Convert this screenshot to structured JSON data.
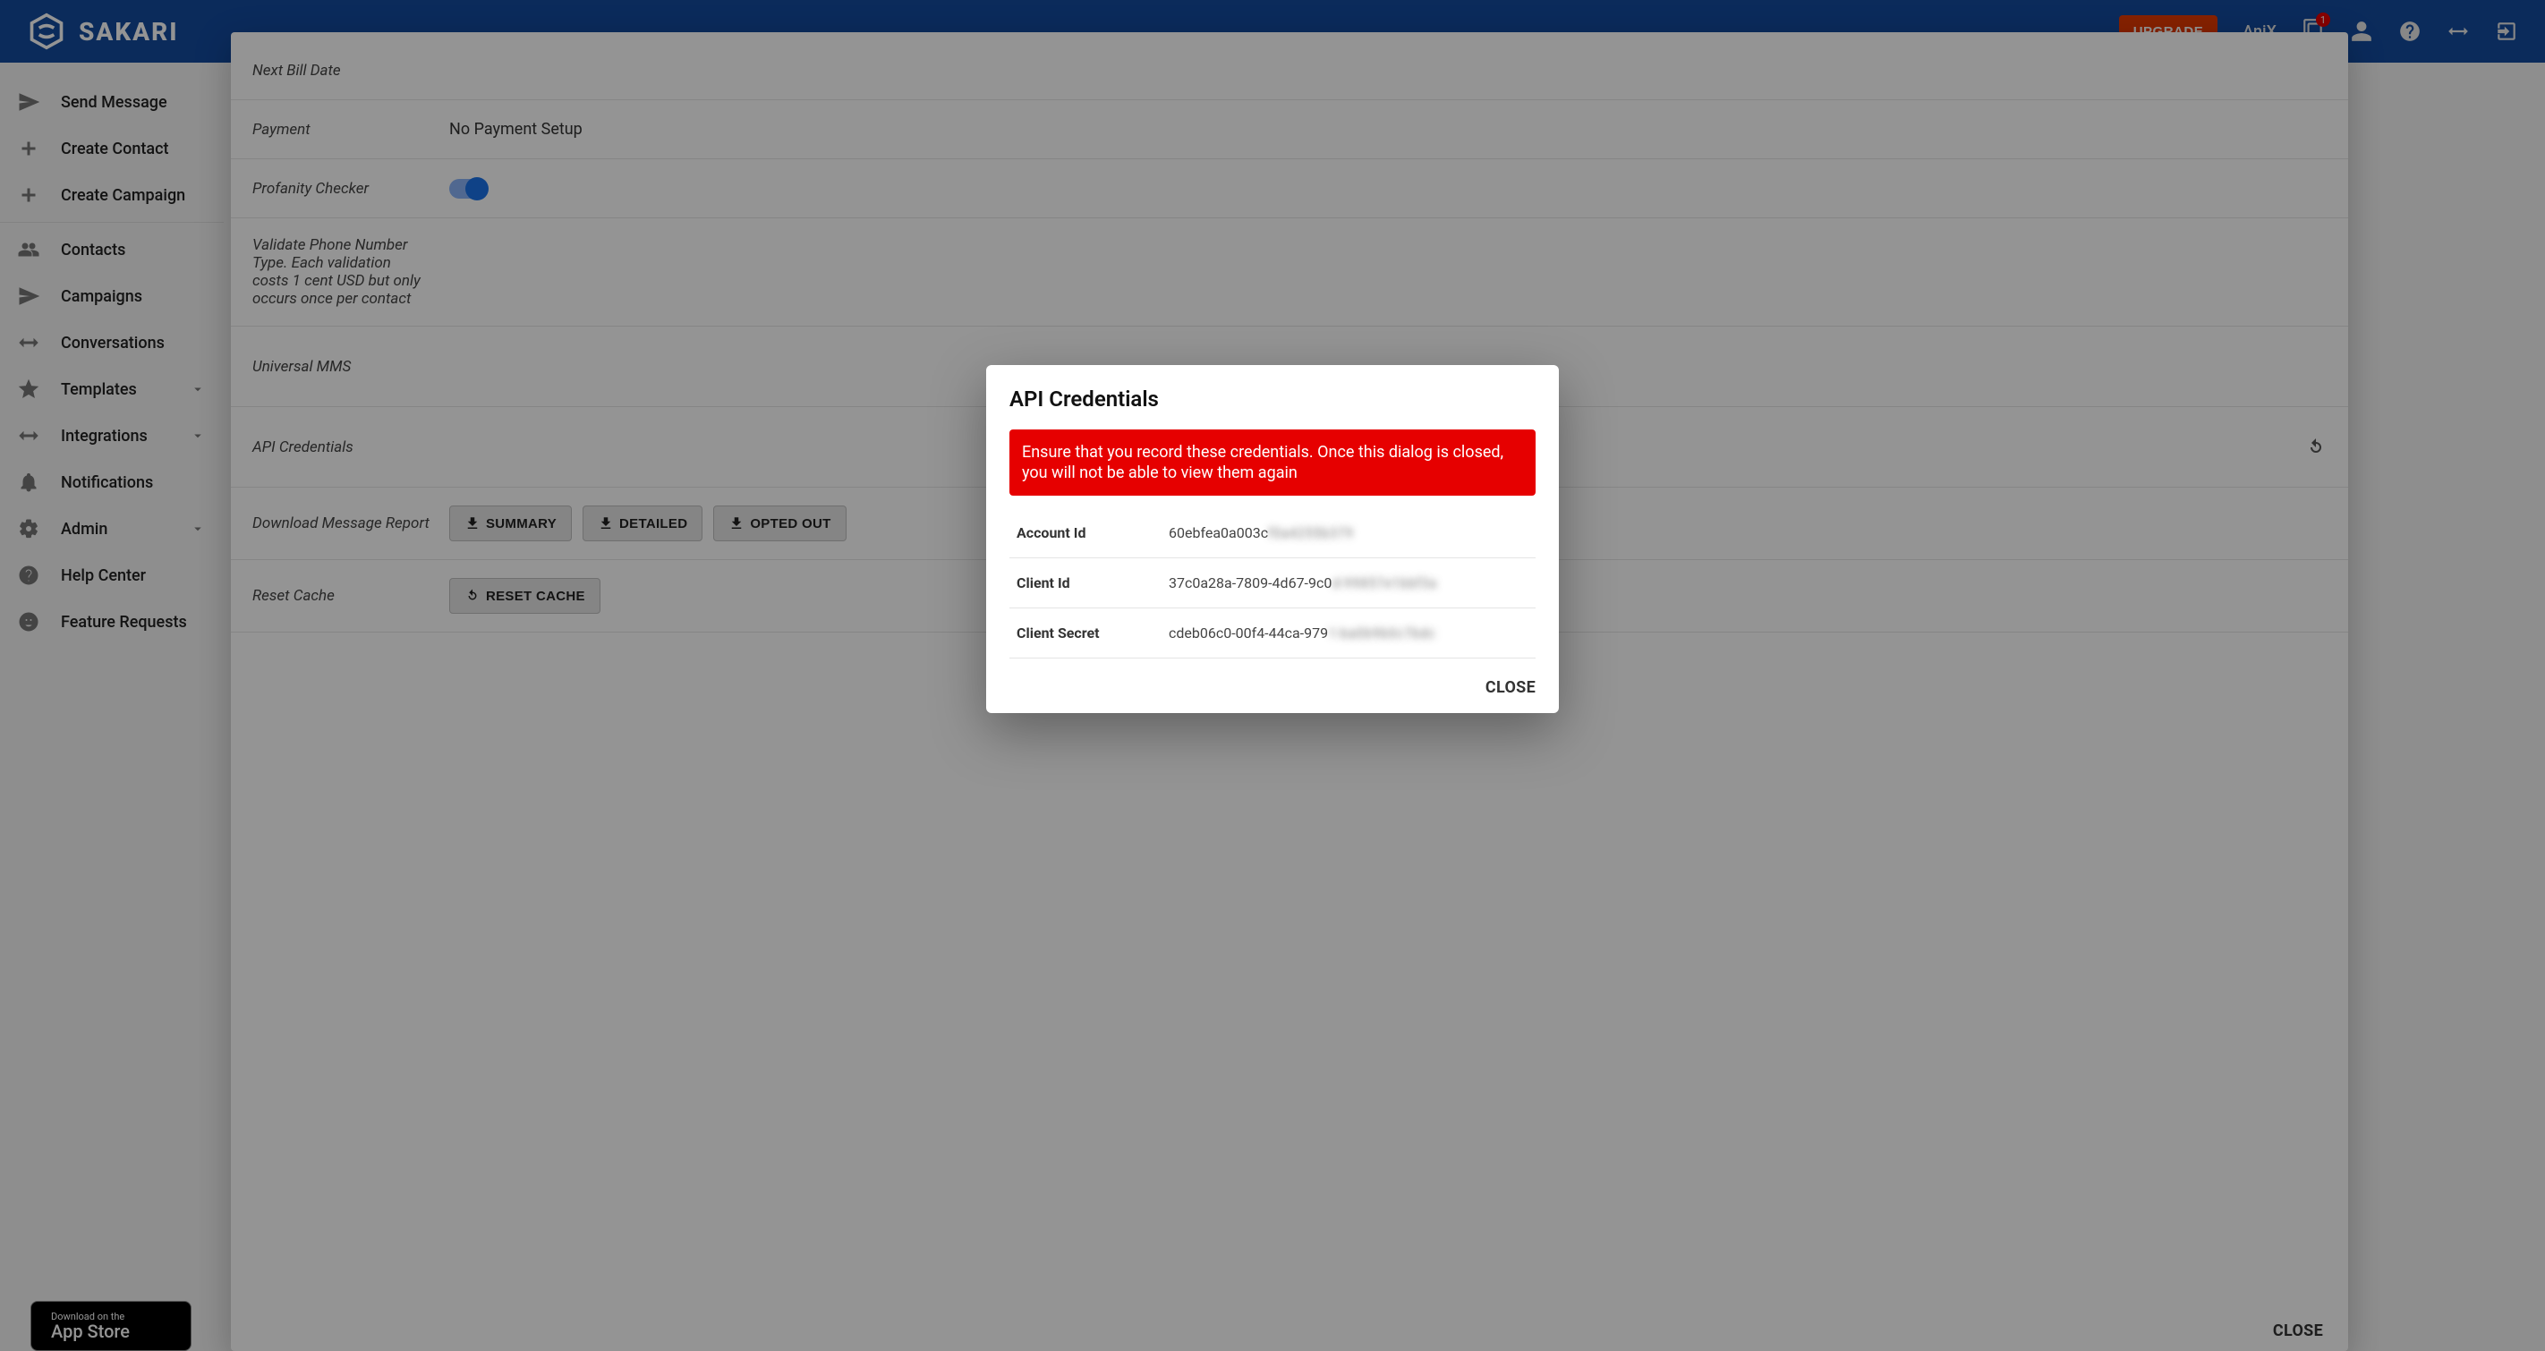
{
  "header": {
    "brand": "SAKARI",
    "upgrade_label": "UPGRADE",
    "org_name": "AniX",
    "notification_badge": "1"
  },
  "sidebar": {
    "items": [
      {
        "label": "Send Message",
        "icon": "send-icon"
      },
      {
        "label": "Create Contact",
        "icon": "plus-icon"
      },
      {
        "label": "Create Campaign",
        "icon": "plus-icon"
      },
      {
        "label": "Contacts",
        "icon": "people-icon"
      },
      {
        "label": "Campaigns",
        "icon": "send-icon"
      },
      {
        "label": "Conversations",
        "icon": "swap-icon"
      },
      {
        "label": "Templates",
        "icon": "star-icon",
        "caret": true
      },
      {
        "label": "Integrations",
        "icon": "swap-icon",
        "caret": true
      },
      {
        "label": "Notifications",
        "icon": "bell-icon"
      },
      {
        "label": "Admin",
        "icon": "gear-icon",
        "caret": true
      },
      {
        "label": "Help Center",
        "icon": "help-icon"
      },
      {
        "label": "Feature Requests",
        "icon": "smile-icon"
      }
    ],
    "divider_after_index": 2,
    "appstore": {
      "small": "Download on the",
      "big": "App Store"
    }
  },
  "settings": {
    "rows": {
      "next_bill_date": {
        "label": "Next Bill Date",
        "value": ""
      },
      "payment": {
        "label": "Payment",
        "value": "No Payment Setup"
      },
      "profanity": {
        "label": "Profanity Checker",
        "toggle": true
      },
      "validate_phone": {
        "label": "Validate Phone Number Type. Each validation costs 1 cent USD but only occurs once per contact"
      },
      "universal_mms": {
        "label": "Universal MMS"
      },
      "api_creds": {
        "label": "API Credentials"
      },
      "download_report": {
        "label": "Download Message Report",
        "buttons": [
          "SUMMARY",
          "DETAILED",
          "OPTED OUT"
        ]
      },
      "reset_cache": {
        "label": "Reset Cache",
        "button": "RESET CACHE"
      }
    },
    "close_label": "CLOSE"
  },
  "modal": {
    "title": "API Credentials",
    "alert": "Ensure that you record these credentials. Once this dialog is closed, you will not be able to view them again",
    "rows": [
      {
        "label": "Account Id",
        "visible": "60ebfea0a003c",
        "hidden": "f0a4255b379"
      },
      {
        "label": "Client Id",
        "visible": "37c0a28a-7809-4d67-9c0",
        "hidden": "d-99857e1bbf3a"
      },
      {
        "label": "Client Secret",
        "visible": "cdeb06c0-00f4-44ca-979",
        "hidden": "1-ba0b9b0c7bdc"
      }
    ],
    "close_label": "CLOSE"
  }
}
